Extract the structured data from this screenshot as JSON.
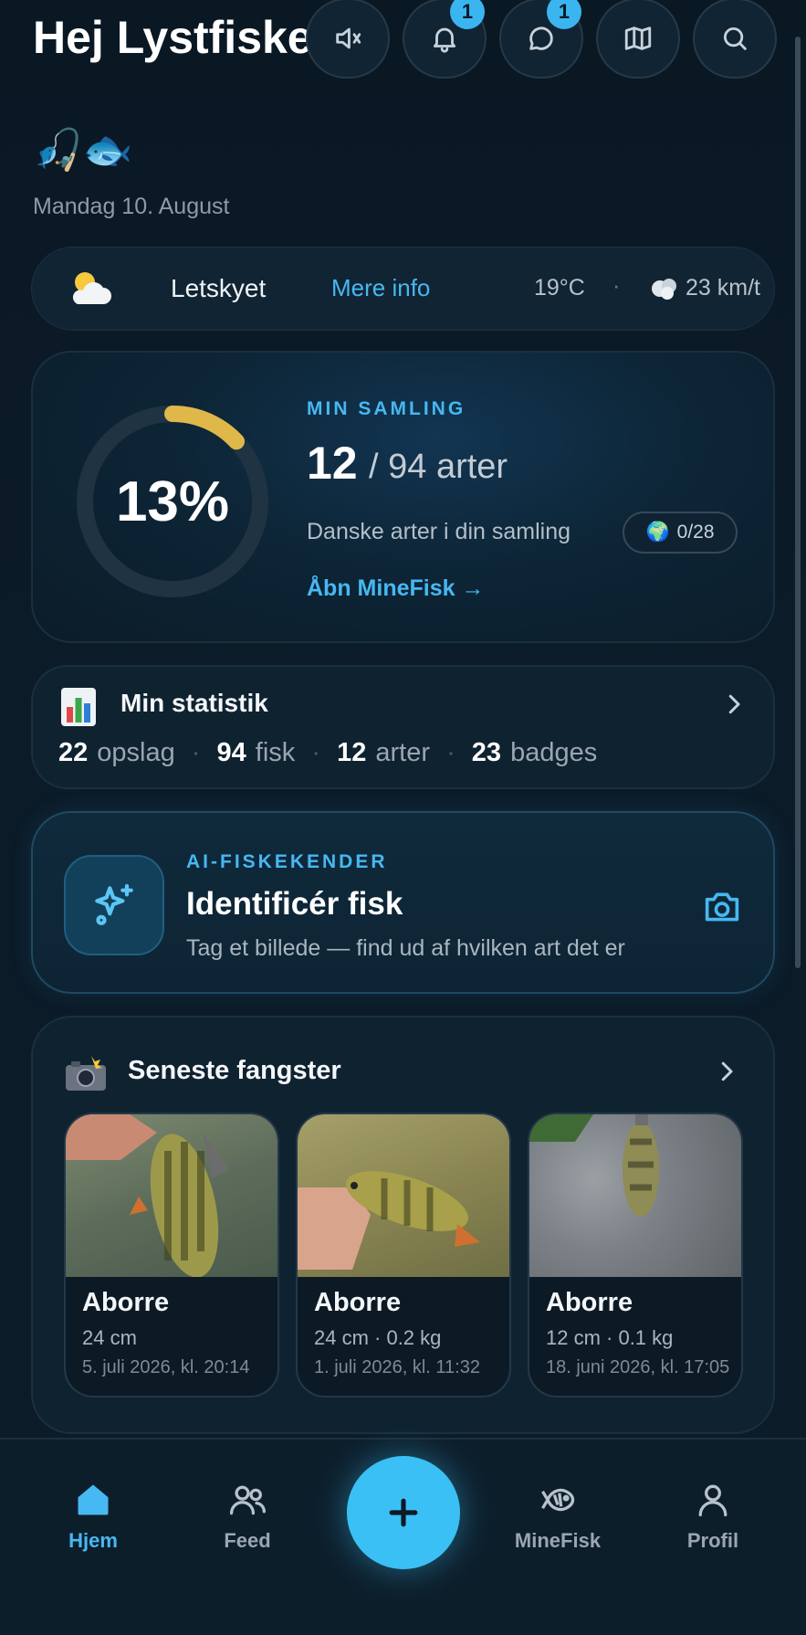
{
  "header": {
    "greeting": "Hej Lystfisker",
    "greeting_emoji": "🎣🐟",
    "date": "Mandag 10. August",
    "icons": [
      {
        "name": "mute-icon",
        "badge": ""
      },
      {
        "name": "bell-icon",
        "badge": "1"
      },
      {
        "name": "chat-icon",
        "badge": "1"
      },
      {
        "name": "map-icon",
        "badge": ""
      },
      {
        "name": "search-icon",
        "badge": ""
      }
    ]
  },
  "weather": {
    "icon": "partly-cloudy-icon",
    "condition": "Letskyet",
    "more_info": "Mere info",
    "temperature": "19°C",
    "separator": "·",
    "wind": "23 km/t"
  },
  "collection": {
    "percent": "13%",
    "percent_value": 0.13,
    "label": "MIN SAMLING",
    "count": "12",
    "total": "/ 94 arter",
    "subtitle": "Danske arter i din samling",
    "pill_icon": "🌍",
    "pill": "0/28",
    "link": "Åbn MineFisk →"
  },
  "stats": {
    "title": "Min statistik",
    "items": [
      {
        "value": "22",
        "label": "opslag"
      },
      {
        "value": "94",
        "label": "fisk"
      },
      {
        "value": "12",
        "label": "arter"
      },
      {
        "value": "23",
        "label": "badges"
      }
    ],
    "separator": "·"
  },
  "ai": {
    "label": "AI-FISKEKENDER",
    "title": "Identificér fisk",
    "subtitle": "Tag et billede — find ud af hvilken art det er"
  },
  "latest": {
    "title": "Seneste fangster",
    "catches": [
      {
        "name": "Aborre",
        "meta": "24 cm",
        "date": "5. juli 2026, kl. 20:14"
      },
      {
        "name": "Aborre",
        "meta": "24 cm · 0.2 kg",
        "date": "1. juli 2026, kl. 11:32"
      },
      {
        "name": "Aborre",
        "meta": "12 cm · 0.1 kg",
        "date": "18. juni 2026, kl. 17:05"
      }
    ]
  },
  "nav": {
    "home": "Hjem",
    "feed": "Feed",
    "add": "+",
    "minefisk": "MineFisk",
    "profile": "Profil"
  },
  "colors": {
    "accent": "#46b8f2",
    "background": "#0b1a26",
    "ring_progress": "#e0b84a"
  }
}
